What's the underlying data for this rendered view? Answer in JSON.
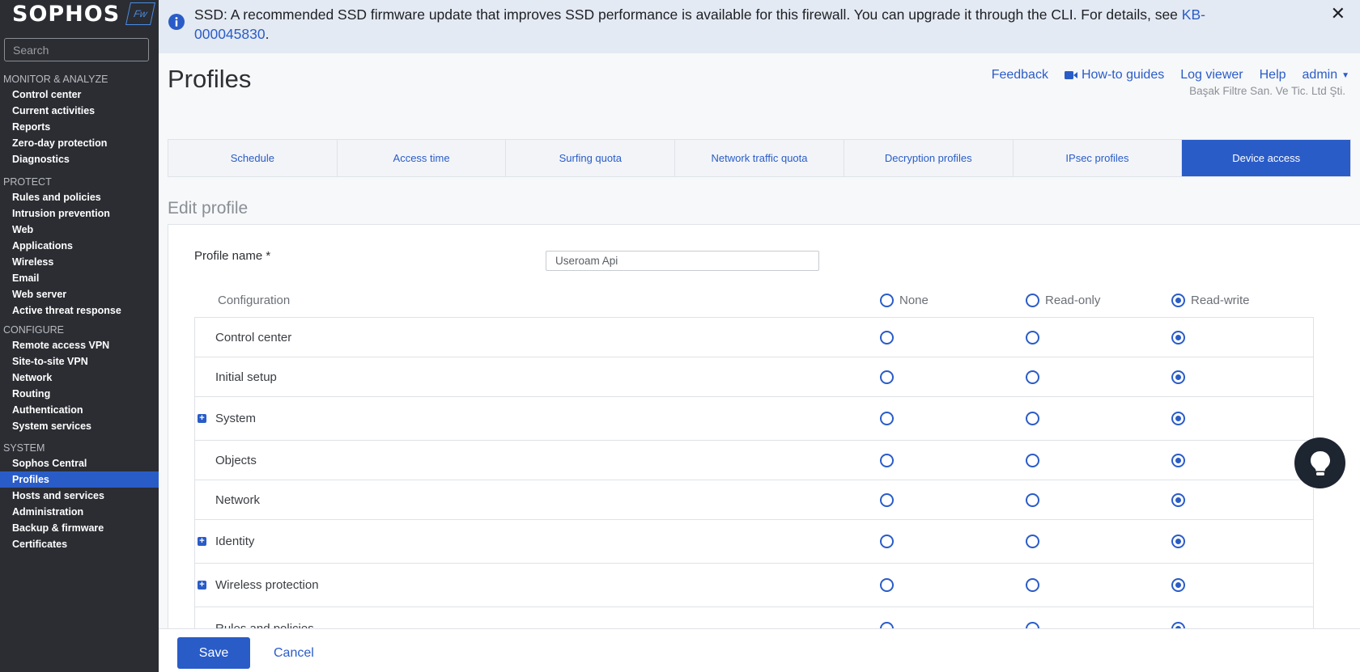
{
  "sidebar": {
    "logo": "SOPHOS",
    "logo_badge": "Fw",
    "search_placeholder": "Search",
    "sections": [
      {
        "heading": "MONITOR & ANALYZE",
        "items": [
          "Control center",
          "Current activities",
          "Reports",
          "Zero-day protection",
          "Diagnostics"
        ]
      },
      {
        "heading": "PROTECT",
        "items": [
          "Rules and policies",
          "Intrusion prevention",
          "Web",
          "Applications",
          "Wireless",
          "Email",
          "Web server",
          "Active threat response"
        ]
      },
      {
        "heading": "CONFIGURE",
        "items": [
          "Remote access VPN",
          "Site-to-site VPN",
          "Network",
          "Routing",
          "Authentication",
          "System services"
        ]
      },
      {
        "heading": "SYSTEM",
        "items": [
          "Sophos Central",
          "Profiles",
          "Hosts and services",
          "Administration",
          "Backup & firmware",
          "Certificates"
        ]
      }
    ],
    "active_item": "Profiles"
  },
  "banner": {
    "text": "SSD: A recommended SSD firmware update that improves SSD performance is available for this firewall. You can upgrade it through the CLI. For details, see ",
    "link": "KB-000045830",
    "suffix": ".",
    "close": "✕"
  },
  "header": {
    "title": "Profiles",
    "links": [
      "Feedback",
      "How-to guides",
      "Log viewer",
      "Help",
      "admin"
    ],
    "org": "Başak Filtre San. Ve Tic. Ltd Şti."
  },
  "tabs": [
    "Schedule",
    "Access time",
    "Surfing quota",
    "Network traffic quota",
    "Decryption profiles",
    "IPsec profiles",
    "Device access"
  ],
  "active_tab": "Device access",
  "edit": {
    "title": "Edit profile",
    "profile_label": "Profile name *",
    "profile_value": "Useroam Api",
    "config_heading": "Configuration",
    "columns": [
      "None",
      "Read-only",
      "Read-write"
    ],
    "column_selected": "Read-write",
    "rows": [
      {
        "label": "Control center",
        "expandable": false,
        "value": "Read-write"
      },
      {
        "label": "Initial setup",
        "expandable": false,
        "value": "Read-write"
      },
      {
        "label": "System",
        "expandable": true,
        "value": "Read-write"
      },
      {
        "label": "Objects",
        "expandable": false,
        "value": "Read-write"
      },
      {
        "label": "Network",
        "expandable": false,
        "value": "Read-write"
      },
      {
        "label": "Identity",
        "expandable": true,
        "value": "Read-write"
      },
      {
        "label": "Wireless protection",
        "expandable": true,
        "value": "Read-write"
      },
      {
        "label": "Rules and policies",
        "expandable": false,
        "value": "Read-write"
      }
    ]
  },
  "footer": {
    "save": "Save",
    "cancel": "Cancel"
  },
  "colors": {
    "accent": "#2a5cc8",
    "sidebar_bg": "#2b2d33",
    "banner_bg": "#e4eaf3"
  }
}
